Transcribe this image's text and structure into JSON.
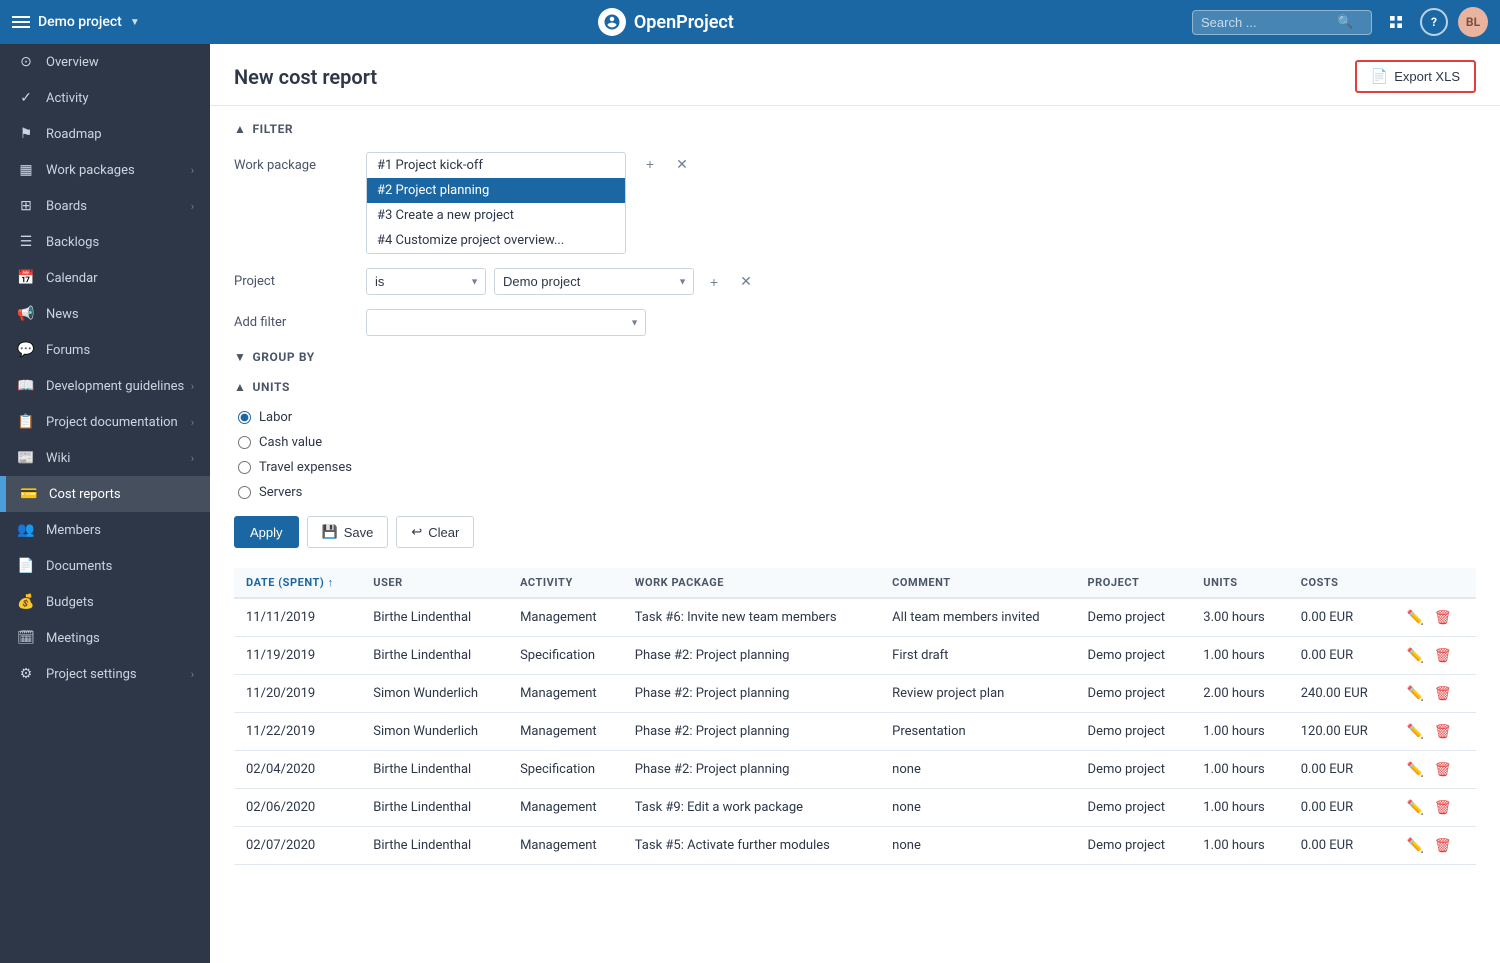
{
  "topbar": {
    "project_name": "Demo project",
    "logo_text": "OpenProject",
    "search_placeholder": "Search ...",
    "export_label": "Export XLS"
  },
  "sidebar": {
    "items": [
      {
        "id": "overview",
        "label": "Overview",
        "icon": "⊙",
        "arrow": false,
        "active": false
      },
      {
        "id": "activity",
        "label": "Activity",
        "icon": "✓",
        "arrow": false,
        "active": false
      },
      {
        "id": "roadmap",
        "label": "Roadmap",
        "icon": "⚑",
        "arrow": false,
        "active": false
      },
      {
        "id": "work-packages",
        "label": "Work packages",
        "icon": "▦",
        "arrow": true,
        "active": false
      },
      {
        "id": "boards",
        "label": "Boards",
        "icon": "⊞",
        "arrow": true,
        "active": false
      },
      {
        "id": "backlogs",
        "label": "Backlogs",
        "icon": "☰",
        "arrow": false,
        "active": false
      },
      {
        "id": "calendar",
        "label": "Calendar",
        "icon": "📅",
        "arrow": false,
        "active": false
      },
      {
        "id": "news",
        "label": "News",
        "icon": "📢",
        "arrow": false,
        "active": false
      },
      {
        "id": "forums",
        "label": "Forums",
        "icon": "💬",
        "arrow": false,
        "active": false
      },
      {
        "id": "dev-guidelines",
        "label": "Development guidelines",
        "icon": "📖",
        "arrow": true,
        "active": false
      },
      {
        "id": "project-doc",
        "label": "Project documentation",
        "icon": "📋",
        "arrow": true,
        "active": false
      },
      {
        "id": "wiki",
        "label": "Wiki",
        "icon": "📰",
        "arrow": true,
        "active": false
      },
      {
        "id": "cost-reports",
        "label": "Cost reports",
        "icon": "💳",
        "arrow": false,
        "active": true
      },
      {
        "id": "members",
        "label": "Members",
        "icon": "👥",
        "arrow": false,
        "active": false
      },
      {
        "id": "documents",
        "label": "Documents",
        "icon": "📄",
        "arrow": false,
        "active": false
      },
      {
        "id": "budgets",
        "label": "Budgets",
        "icon": "💰",
        "arrow": false,
        "active": false
      },
      {
        "id": "meetings",
        "label": "Meetings",
        "icon": "🗓",
        "arrow": false,
        "active": false
      },
      {
        "id": "project-settings",
        "label": "Project settings",
        "icon": "⚙",
        "arrow": true,
        "active": false
      }
    ]
  },
  "page": {
    "title": "New cost report",
    "filter_section": "FILTER",
    "group_by_section": "GROUP BY",
    "units_section": "UNITS"
  },
  "filter": {
    "work_package_label": "Work package",
    "work_package_options": [
      {
        "id": 1,
        "label": "#1 Project kick-off",
        "selected": false
      },
      {
        "id": 2,
        "label": "#2 Project planning",
        "selected": true
      },
      {
        "id": 3,
        "label": "#3 Create a new project",
        "selected": false
      },
      {
        "id": 4,
        "label": "#4 Customize project overview...",
        "selected": false
      }
    ],
    "project_label": "Project",
    "project_operator": "is",
    "project_value": "Demo project",
    "add_filter_label": "Add filter",
    "add_filter_placeholder": ""
  },
  "units": {
    "options": [
      {
        "id": "labor",
        "label": "Labor",
        "selected": true
      },
      {
        "id": "cash-value",
        "label": "Cash value",
        "selected": false
      },
      {
        "id": "travel-expenses",
        "label": "Travel expenses",
        "selected": false
      },
      {
        "id": "servers",
        "label": "Servers",
        "selected": false
      }
    ]
  },
  "buttons": {
    "apply": "Apply",
    "save": "Save",
    "clear": "Clear"
  },
  "table": {
    "columns": [
      {
        "id": "date",
        "label": "DATE (SPENT)",
        "sorted": true
      },
      {
        "id": "user",
        "label": "USER"
      },
      {
        "id": "activity",
        "label": "ACTIVITY"
      },
      {
        "id": "work_package",
        "label": "WORK PACKAGE"
      },
      {
        "id": "comment",
        "label": "COMMENT"
      },
      {
        "id": "project",
        "label": "PROJECT"
      },
      {
        "id": "units",
        "label": "UNITS"
      },
      {
        "id": "costs",
        "label": "COSTS"
      }
    ],
    "rows": [
      {
        "date": "11/11/2019",
        "user": "Birthe Lindenthal",
        "activity": "Management",
        "work_package": "Task #6: Invite new team members",
        "comment": "All team members invited",
        "project": "Demo project",
        "units": "3.00 hours",
        "costs": "0.00 EUR"
      },
      {
        "date": "11/19/2019",
        "user": "Birthe Lindenthal",
        "activity": "Specification",
        "work_package": "Phase #2: Project planning",
        "comment": "First draft",
        "project": "Demo project",
        "units": "1.00 hours",
        "costs": "0.00 EUR"
      },
      {
        "date": "11/20/2019",
        "user": "Simon Wunderlich",
        "activity": "Management",
        "work_package": "Phase #2: Project planning",
        "comment": "Review project plan",
        "project": "Demo project",
        "units": "2.00 hours",
        "costs": "240.00 EUR"
      },
      {
        "date": "11/22/2019",
        "user": "Simon Wunderlich",
        "activity": "Management",
        "work_package": "Phase #2: Project planning",
        "comment": "Presentation",
        "project": "Demo project",
        "units": "1.00 hours",
        "costs": "120.00 EUR"
      },
      {
        "date": "02/04/2020",
        "user": "Birthe Lindenthal",
        "activity": "Specification",
        "work_package": "Phase #2: Project planning",
        "comment": "none",
        "project": "Demo project",
        "units": "1.00 hours",
        "costs": "0.00 EUR"
      },
      {
        "date": "02/06/2020",
        "user": "Birthe Lindenthal",
        "activity": "Management",
        "work_package": "Task #9: Edit a work package",
        "comment": "none",
        "project": "Demo project",
        "units": "1.00 hours",
        "costs": "0.00 EUR"
      },
      {
        "date": "02/07/2020",
        "user": "Birthe Lindenthal",
        "activity": "Management",
        "work_package": "Task #5: Activate further modules",
        "comment": "none",
        "project": "Demo project",
        "units": "1.00 hours",
        "costs": "0.00 EUR"
      }
    ]
  }
}
